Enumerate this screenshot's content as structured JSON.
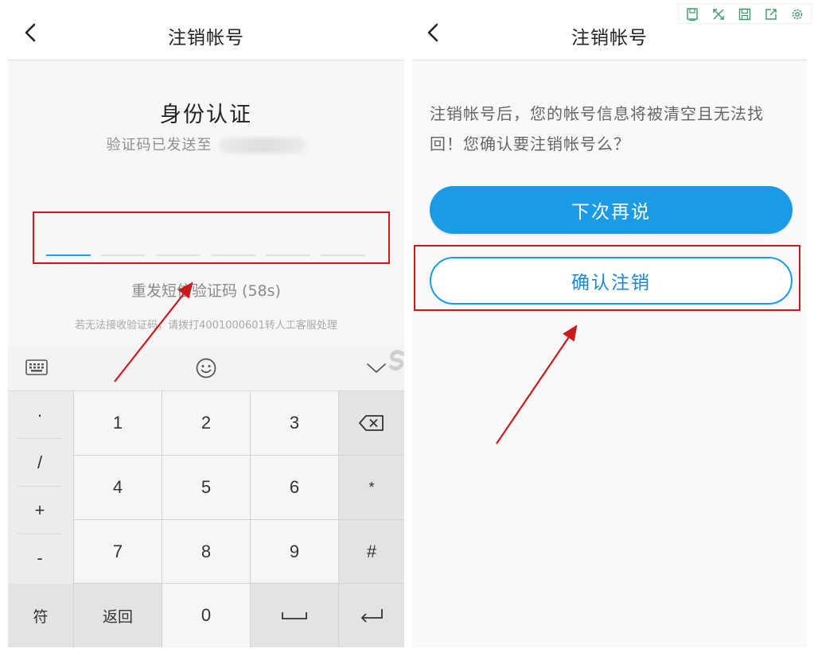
{
  "left_page": {
    "title": "注销帐号",
    "verify_title": "身份认证",
    "sent_text": "验证码已发送至",
    "resend_text": "重发短信验证码 (58s)",
    "hint_text": "若无法接收验证码，请拨打4001000601转人工客服处理"
  },
  "keyboard": {
    "toolbar_icons": [
      "keyboard-icon",
      "emoji-icon",
      "chevron-down-icon"
    ],
    "symbols": [
      "·",
      "/",
      "+",
      "-"
    ],
    "digits": [
      "1",
      "2",
      "3",
      "4",
      "5",
      "6",
      "7",
      "8",
      "9"
    ],
    "right_keys": [
      "*",
      "#"
    ],
    "bottom_keys": {
      "symbols": "符",
      "back": "返回",
      "zero": "0"
    },
    "icons": [
      "backspace-icon",
      "space-icon",
      "enter-icon"
    ]
  },
  "right_page": {
    "title": "注销帐号",
    "confirm_text": "注销帐号后，您的帐号信息将被清空且无法找回！您确认要注销帐号么？",
    "later_button": "下次再说",
    "confirm_button": "确认注销"
  },
  "window_toolbar": {
    "icons": [
      "save-icon",
      "expand-icon",
      "floppy-icon",
      "share-icon",
      "settings-icon"
    ]
  },
  "colors": {
    "accent_blue": "#1b9ae6",
    "annotation_red": "#c81b1b",
    "active_slot": "#2d9bdf"
  }
}
